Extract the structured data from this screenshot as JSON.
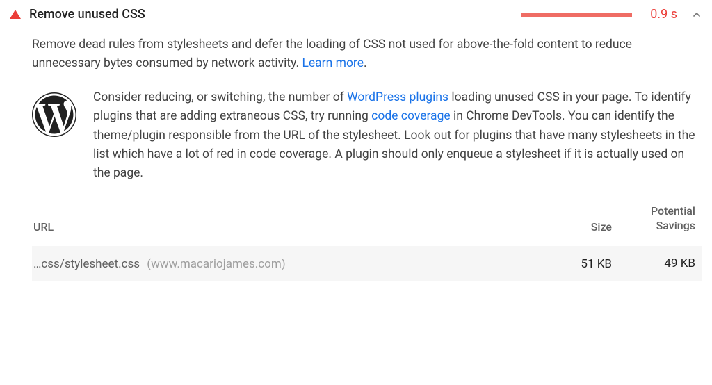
{
  "audit": {
    "title": "Remove unused CSS",
    "time_value": "0.9 s",
    "description_part1": "Remove dead rules from stylesheets and defer the loading of CSS not used for above-the-fold content to reduce unnecessary bytes consumed by network activity. ",
    "learn_more": "Learn more",
    "period": "."
  },
  "stackpack": {
    "text1": "Consider reducing, or switching, the number of ",
    "link1": "WordPress plugins",
    "text2": " loading unused CSS in your page. To identify plugins that are adding extraneous CSS, try running ",
    "link2": "code coverage",
    "text3": " in Chrome DevTools. You can identify the theme/plugin responsible from the URL of the stylesheet. Look out for plugins that have many stylesheets in the list which have a lot of red in code coverage. A plugin should only enqueue a stylesheet if it is actually used on the page."
  },
  "table": {
    "headers": {
      "url": "URL",
      "size": "Size",
      "savings_line1": "Potential",
      "savings_line2": "Savings"
    },
    "row": {
      "url": "…css/stylesheet.css",
      "domain": "(www.macariojames.com)",
      "size": "51 KB",
      "savings": "49 KB"
    }
  }
}
